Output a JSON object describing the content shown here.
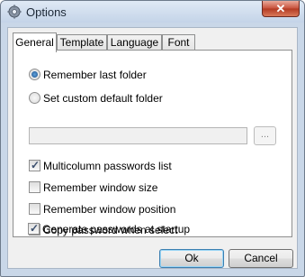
{
  "window": {
    "title": "Options",
    "close_label": "✕"
  },
  "tabs": [
    "General",
    "Template",
    "Language",
    "Font"
  ],
  "active_tab": "General",
  "options": {
    "remember_last_folder": {
      "label": "Remember last folder",
      "selected": true
    },
    "set_custom_default_folder": {
      "label": "Set custom default folder",
      "selected": false
    },
    "custom_folder_value": "",
    "browse_label": "...",
    "checkboxes": [
      {
        "label": "Multicolumn passwords list",
        "checked": true
      },
      {
        "label": "Remember window size",
        "checked": false
      },
      {
        "label": "Remember window position",
        "checked": false
      },
      {
        "label": "Copy password when select",
        "checked": false
      },
      {
        "label": "Generate passwords at startup",
        "checked": true
      }
    ]
  },
  "buttons": {
    "ok": "Ok",
    "cancel": "Cancel"
  },
  "icons": {
    "title": "gear-icon",
    "close": "close-icon",
    "check": "checkmark-icon"
  }
}
